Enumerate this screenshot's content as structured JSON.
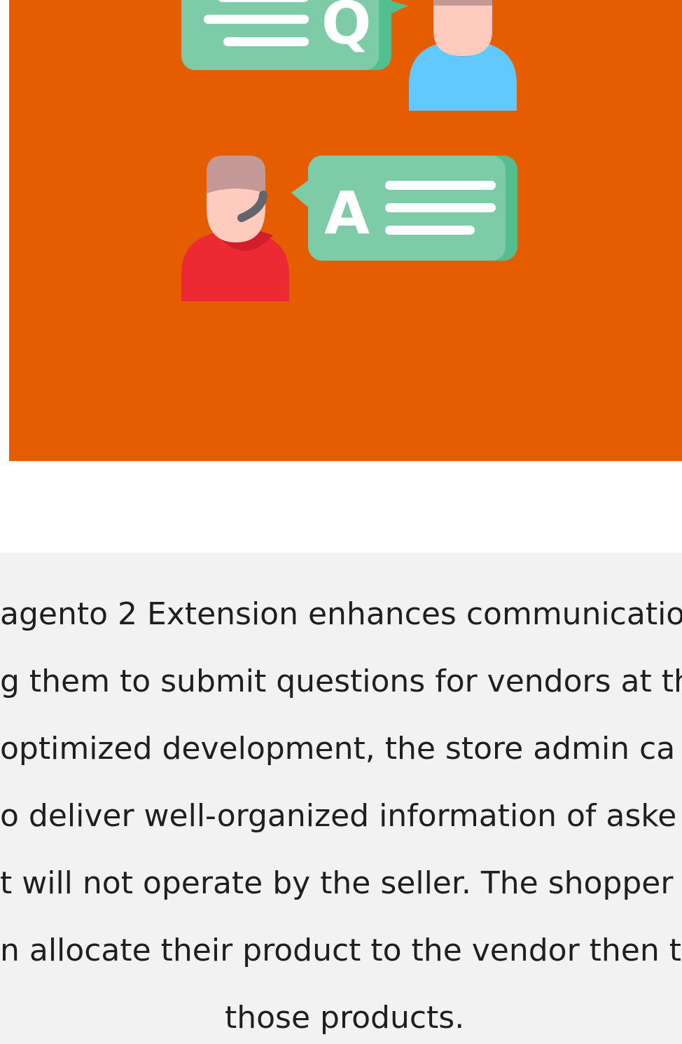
{
  "hero": {
    "background_color": "#E65C00",
    "icons": [
      "question-bubble-icon",
      "customer-icon",
      "support-agent-icon",
      "answer-bubble-icon"
    ],
    "question_glyph": "Q",
    "answer_glyph": "A"
  },
  "description": {
    "background_color": "#F2F2F2",
    "text_color": "#1F1F1F",
    "lines": [
      "agento 2 Extension enhances communicatio",
      "g them to submit questions for vendors at th",
      "optimized development, the store admin ca",
      "o deliver well-organized information of aske",
      "t will not operate by the seller. The shopper",
      "n allocate their product to the vendor then th",
      "those products."
    ]
  }
}
